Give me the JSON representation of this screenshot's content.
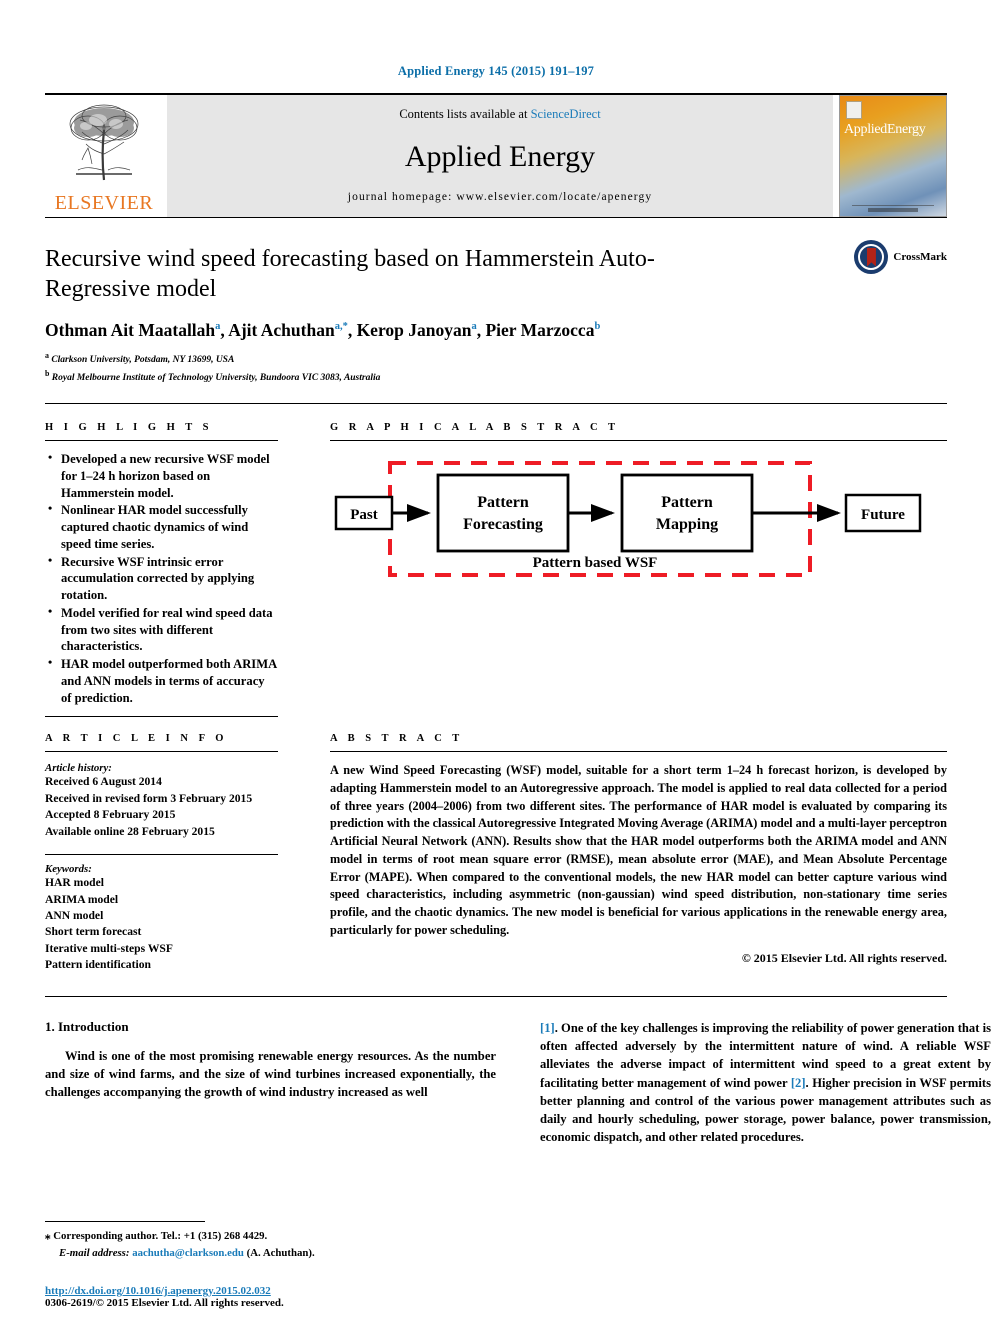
{
  "running_head": "Applied Energy 145 (2015) 191–197",
  "masthead": {
    "publisher_wordmark": "ELSEVIER",
    "contents_prefix": "Contents lists available at ",
    "contents_link": "ScienceDirect",
    "journal_name": "Applied Energy",
    "homepage": "journal homepage: www.elsevier.com/locate/apenergy",
    "cover_title_a": "Applied",
    "cover_title_b": "Energy"
  },
  "crossmark": {
    "label": "CrossMark"
  },
  "title": "Recursive wind speed forecasting based on Hammerstein Auto-Regressive model",
  "authors": [
    {
      "name": "Othman Ait Maatallah",
      "sup": "a",
      "sep": ", "
    },
    {
      "name": "Ajit Achuthan",
      "sup": "a,*",
      "sep": ", "
    },
    {
      "name": "Kerop Janoyan",
      "sup": "a",
      "sep": ", "
    },
    {
      "name": "Pier Marzocca",
      "sup": "b",
      "sep": ""
    }
  ],
  "affiliations": [
    {
      "mark": "a",
      "text": "Clarkson University, Potsdam, NY 13699, USA"
    },
    {
      "mark": "b",
      "text": "Royal Melbourne Institute of Technology University, Bundoora VIC 3083, Australia"
    }
  ],
  "highlights": {
    "heading": "H I G H L I G H T S",
    "items": [
      "Developed a new recursive WSF model for 1–24 h horizon based on Hammerstein model.",
      "Nonlinear HAR model successfully captured chaotic dynamics of wind speed time series.",
      "Recursive WSF intrinsic error accumulation corrected by applying rotation.",
      "Model verified for real wind speed data from two sites with different characteristics.",
      "HAR model outperformed both ARIMA and ANN models in terms of accuracy of prediction."
    ]
  },
  "graphical_abstract": {
    "heading": "G R A P H I C A L  A B S T R A C T",
    "nodes": {
      "past": "Past",
      "pattern_forecasting_line1": "Pattern",
      "pattern_forecasting_line2": "Forecasting",
      "pattern_mapping_line1": "Pattern",
      "pattern_mapping_line2": "Mapping",
      "future": "Future"
    },
    "group_label": "Pattern based WSF",
    "group_border_color": "#ee1c25"
  },
  "article_info": {
    "heading": "A R T I C L E  I N F O",
    "history_title": "Article history:",
    "history": [
      "Received 6 August 2014",
      "Received in revised form 3 February 2015",
      "Accepted 8 February 2015",
      "Available online 28 February 2015"
    ],
    "keywords_title": "Keywords:",
    "keywords": [
      "HAR model",
      "ARIMA model",
      "ANN model",
      "Short term forecast",
      "Iterative multi-steps WSF",
      "Pattern identification"
    ]
  },
  "abstract": {
    "heading": "A B S T R A C T",
    "text": "A new Wind Speed Forecasting (WSF) model, suitable for a short term 1–24 h forecast horizon, is developed by adapting Hammerstein model to an Autoregressive approach. The model is applied to real data collected for a period of three years (2004–2006) from two different sites. The performance of HAR model is evaluated by comparing its prediction with the classical Autoregressive Integrated Moving Average (ARIMA) model and a multi-layer perceptron Artificial Neural Network (ANN). Results show that the HAR model outperforms both the ARIMA model and ANN model in terms of root mean square error (RMSE), mean absolute error (MAE), and Mean Absolute Percentage Error (MAPE). When compared to the conventional models, the new HAR model can better capture various wind speed characteristics, including asymmetric (non-gaussian) wind speed distribution, non-stationary time series profile, and the chaotic dynamics. The new model is beneficial for various applications in the renewable energy area, particularly for power scheduling.",
    "copyright": "© 2015 Elsevier Ltd. All rights reserved."
  },
  "introduction": {
    "heading": "1. Introduction",
    "left_paragraph": "Wind is one of the most promising renewable energy resources. As the number and size of wind farms, and the size of wind turbines increased exponentially, the challenges accompanying the growth of wind industry increased as well",
    "right_citation_1": "[1]",
    "right_paragraph_part1": ". One of the key challenges is improving the reliability of power generation that is often affected adversely by the intermittent nature of wind. A reliable WSF alleviates the adverse impact of intermittent wind speed to a great extent by facilitating better management of wind power ",
    "right_citation_2": "[2]",
    "right_paragraph_part2": ". Higher precision in WSF permits better planning and control of the various power management attributes such as daily and hourly scheduling, power storage, power balance, power transmission, economic dispatch, and other related procedures."
  },
  "footnotes": {
    "corresponding": "Corresponding author. Tel.: +1 (315) 268 4429.",
    "email_label": "E-mail address:",
    "email": "aachutha@clarkson.edu",
    "email_suffix": "(A. Achuthan).",
    "doi": "http://dx.doi.org/10.1016/j.apenergy.2015.02.032",
    "issn": "0306-2619/© 2015 Elsevier Ltd. All rights reserved."
  },
  "colors": {
    "link_blue": "#1a7bb9",
    "elsevier_orange": "#e87722",
    "diagram_red": "#ee1c25"
  }
}
